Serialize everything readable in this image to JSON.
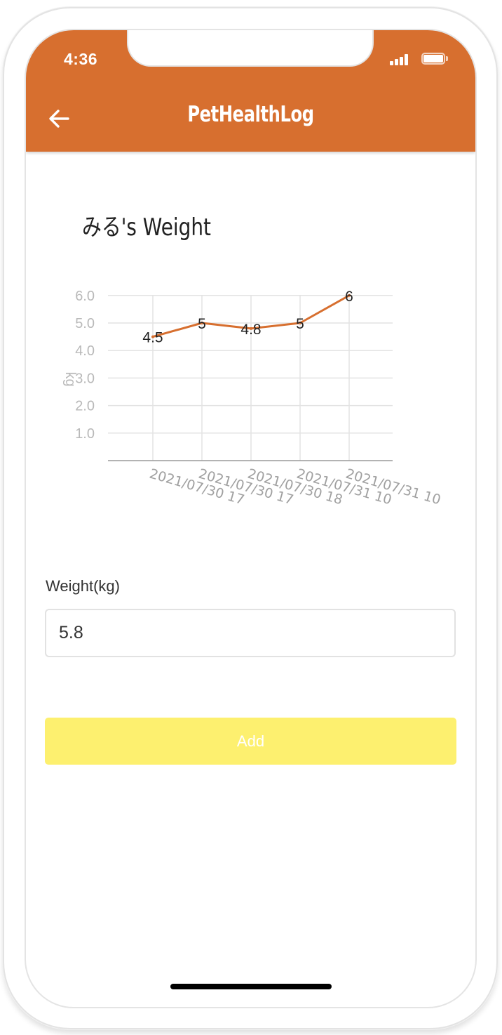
{
  "status_bar": {
    "time": "4:36"
  },
  "header": {
    "title": "PetHealthLog",
    "back_icon": "arrow-left-icon",
    "background": "#d76f2f"
  },
  "chart_data": {
    "type": "line",
    "title": "みる's Weight",
    "ylabel": "kg",
    "xlabel": "",
    "categories": [
      "2021/07/30 17",
      "2021/07/30 17",
      "2021/07/30 18",
      "2021/07/31 10",
      "2021/07/31 10"
    ],
    "series": [
      {
        "values": [
          4.5,
          5,
          4.8,
          5,
          6
        ],
        "data_labels": [
          "4.5",
          "5",
          "4.8",
          "5",
          "6"
        ],
        "color": "#d76f2f"
      }
    ],
    "yticks": [
      "1.0",
      "2.0",
      "3.0",
      "4.0",
      "5.0",
      "6.0"
    ],
    "ylim": [
      0,
      6
    ],
    "grid": true
  },
  "form": {
    "weight_label": "Weight(kg)",
    "weight_value": "5.8",
    "add_label": "Add",
    "add_color": "#fdf06f"
  }
}
